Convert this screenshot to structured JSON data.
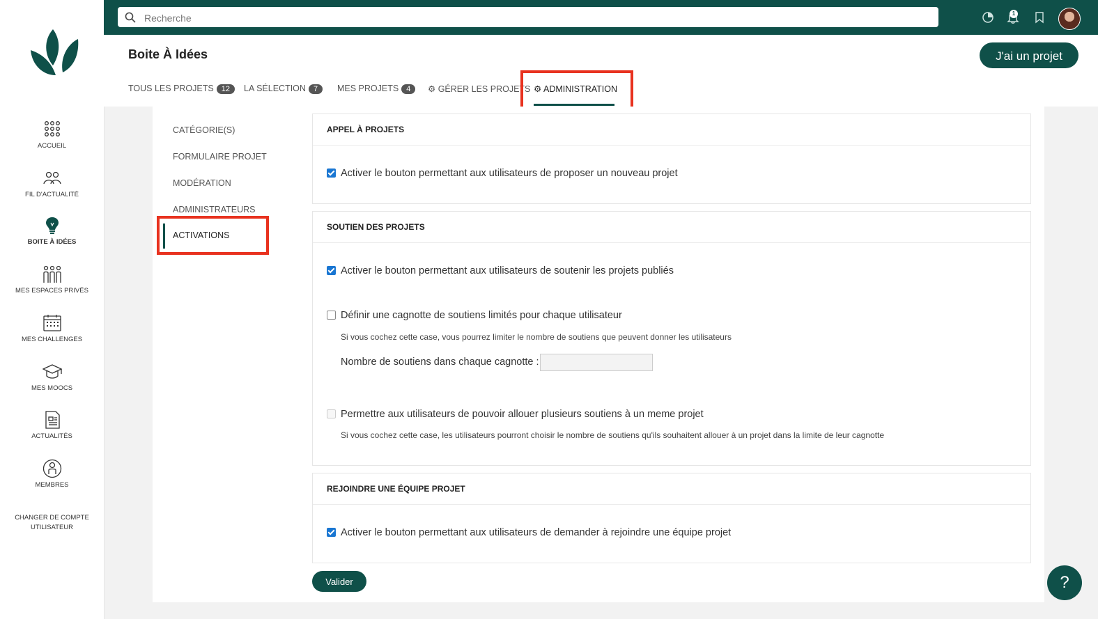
{
  "brand": {
    "accent": "#0f5049",
    "highlight": "#e8321f"
  },
  "sidebar": {
    "logo_icon": "leaf-logo-icon",
    "items": [
      {
        "label": "ACCUEIL",
        "icon": "grid-dots-icon"
      },
      {
        "label": "FIL D'ACTUALITÉ",
        "icon": "people-group-icon"
      },
      {
        "label": "BOITE À IDÉES",
        "icon": "lightbulb-icon",
        "active": true
      },
      {
        "label": "MES ESPACES PRIVÉS",
        "icon": "users-icon"
      },
      {
        "label": "MES CHALLENGES",
        "icon": "calendar-icon"
      },
      {
        "label": "MES MOOCS",
        "icon": "graduation-cap-icon"
      },
      {
        "label": "ACTUALITÉS",
        "icon": "document-icon"
      },
      {
        "label": "MEMBRES",
        "icon": "member-icon"
      }
    ],
    "switch_account": "CHANGER DE COMPTE UTILISATEUR"
  },
  "topbar": {
    "search_placeholder": "Recherche",
    "notif_count": "1"
  },
  "header": {
    "title": "Boite À Idées",
    "project_button": "J'ai un projet",
    "tabs": [
      {
        "label": "TOUS LES PROJETS",
        "count": "12"
      },
      {
        "label": "LA SÉLECTION",
        "count": "7"
      },
      {
        "label": "MES PROJETS",
        "count": "4"
      },
      {
        "label": "GÉRER LES PROJETS",
        "icon": "gear-icon"
      },
      {
        "label": "ADMINISTRATION",
        "icon": "gear-icon",
        "active": true
      }
    ]
  },
  "subnav": {
    "items": [
      "CATÉGORIE(S)",
      "FORMULAIRE PROJET",
      "MODÉRATION",
      "ADMINISTRATEURS",
      "ACTIVATIONS"
    ],
    "active": "ACTIVATIONS"
  },
  "sections": {
    "appel": {
      "title": "APPEL À PROJETS",
      "option": {
        "label": "Activer le bouton permettant aux utilisateurs de proposer un nouveau projet",
        "checked": true
      }
    },
    "soutien": {
      "title": "SOUTIEN DES PROJETS",
      "option1": {
        "label": "Activer le bouton permettant aux utilisateurs de soutenir les projets publiés",
        "checked": true
      },
      "option2": {
        "label": "Définir une cagnotte de soutiens limités pour chaque utilisateur",
        "checked": false
      },
      "option2_hint": "Si vous cochez cette case, vous pourrez limiter le nombre de soutiens que peuvent donner les utilisateurs",
      "field_label": "Nombre de soutiens dans chaque cagnotte :",
      "field_value": "",
      "option3": {
        "label": "Permettre aux utilisateurs de pouvoir allouer plusieurs soutiens à un meme projet",
        "checked": false,
        "disabled": true
      },
      "option3_hint": "Si vous cochez cette case, les utilisateurs pourront choisir le nombre de soutiens qu'ils souhaitent allouer à un projet dans la limite de leur cagnotte"
    },
    "equipe": {
      "title": "REJOINDRE UNE ÉQUIPE PROJET",
      "option": {
        "label": "Activer le bouton permettant aux utilisateurs de demander à rejoindre une équipe projet",
        "checked": true
      }
    }
  },
  "submit_label": "Valider",
  "help_label": "?"
}
